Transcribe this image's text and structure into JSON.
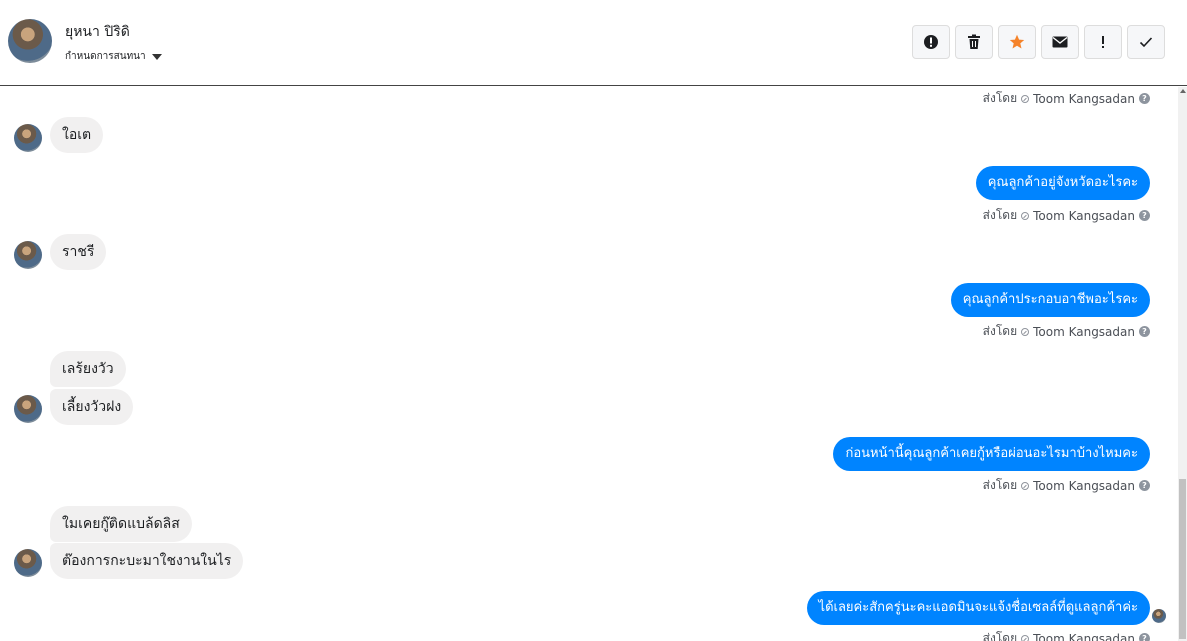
{
  "header": {
    "name": "ยุหนา ปิริดิ",
    "subtitle": "กำหนดการสนทนา",
    "toolbar": [
      {
        "name": "report-icon",
        "label": "report"
      },
      {
        "name": "trash-icon",
        "label": "delete"
      },
      {
        "name": "star-icon",
        "label": "star"
      },
      {
        "name": "envelope-icon",
        "label": "mark unread"
      },
      {
        "name": "exclamation-icon",
        "label": "spam"
      },
      {
        "name": "check-icon",
        "label": "done"
      }
    ],
    "accent_star": "#f5832a"
  },
  "messages": {
    "sent_by_label": "ส่งโดย",
    "agent_name": "Toom Kangsadan",
    "in_1": "ใอเต",
    "out_1": "คุณลูกค้าอยู่จังหวัดอะไรคะ",
    "in_2": "ราชรี",
    "out_2": "คุณลูกค้าประกอบอาชีพอะไรคะ",
    "in_3a": "เลร้ยงวัว",
    "in_3b": "เลี้ยงวัวฝง",
    "out_3": "ก่อนหน้านี้คุณลูกค้าเคยกู้หรือผ่อนอะไรมาบ้างไหมคะ",
    "in_4a": "ใมเคยกู๊ติดแบล้ดลิส",
    "in_4b": "ต๊องการกะบะมาใชงานในไร",
    "out_4": "ได้เลยค่ะสักครู่นะคะแอดมินจะแจ้งชื่อเซลล์ที่ดูแลลูกค้าค่ะ"
  },
  "colors": {
    "outgoing_bubble": "#0084ff",
    "incoming_bubble": "#f1f0f0"
  }
}
